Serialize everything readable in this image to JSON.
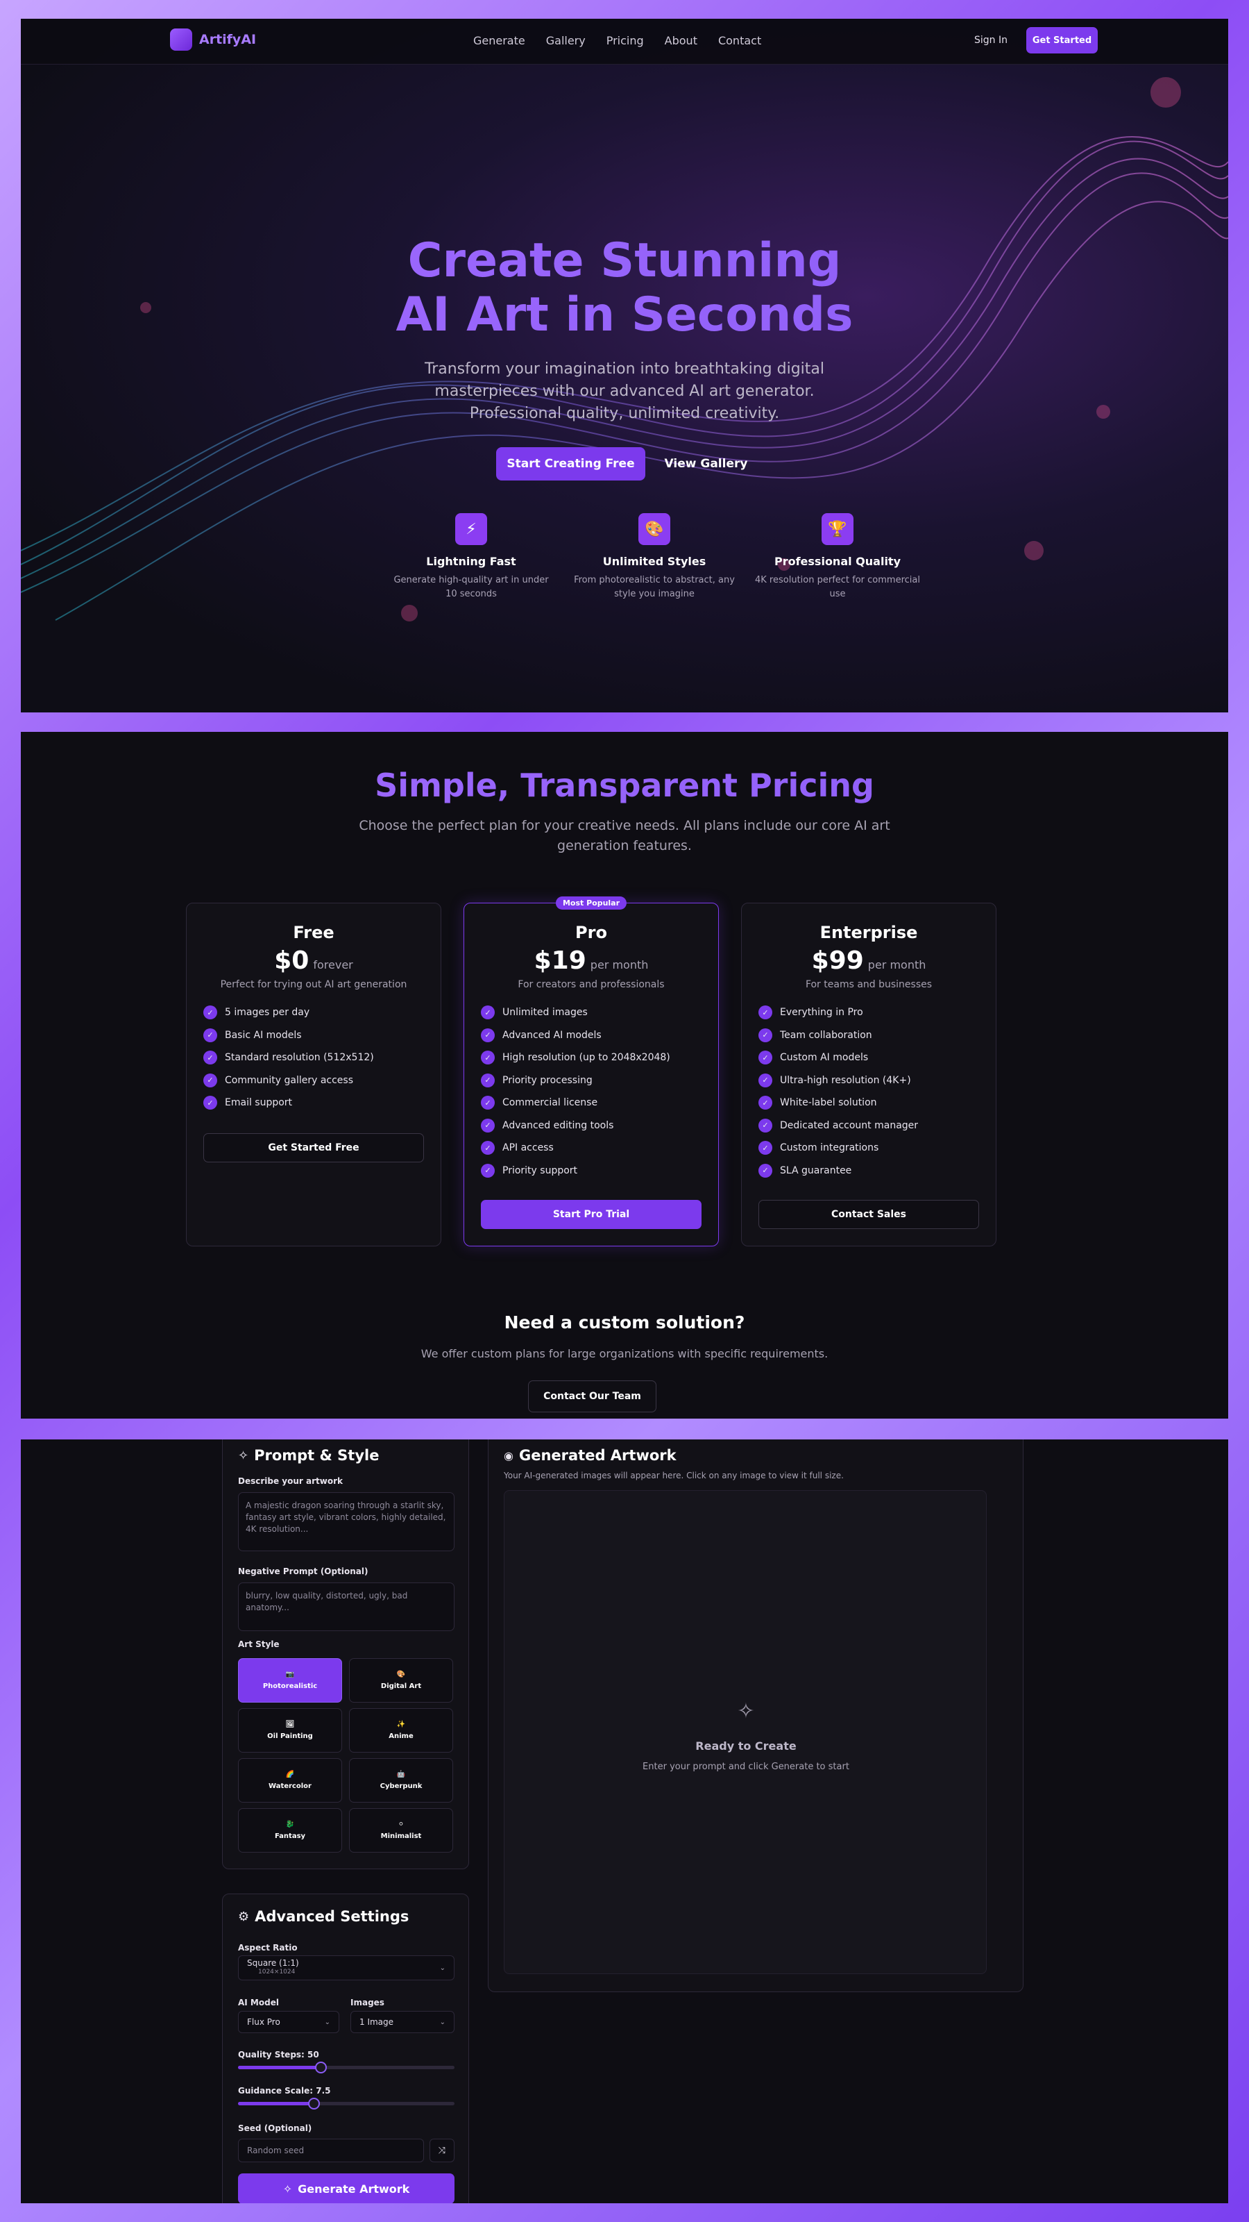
{
  "nav": {
    "brand": "ArtifyAI",
    "links": [
      "Generate",
      "Gallery",
      "Pricing",
      "About",
      "Contact"
    ],
    "sign_in": "Sign In",
    "get_started": "Get Started"
  },
  "hero": {
    "title_line1": "Create Stunning",
    "title_line2": "AI Art in Seconds",
    "subtitle": "Transform your imagination into breathtaking digital masterpieces with our advanced AI art generator. Professional quality, unlimited creativity.",
    "primary_cta": "Start Creating Free",
    "secondary_cta": "View Gallery",
    "features": [
      {
        "icon": "lightning-icon",
        "glyph": "⚡",
        "title": "Lightning Fast",
        "desc": "Generate high-quality art in under 10 seconds"
      },
      {
        "icon": "palette-icon",
        "glyph": "🎨",
        "title": "Unlimited Styles",
        "desc": "From photorealistic to abstract, any style you imagine"
      },
      {
        "icon": "trophy-icon",
        "glyph": "🏆",
        "title": "Professional Quality",
        "desc": "4K resolution perfect for commercial use"
      }
    ]
  },
  "pricing": {
    "title": "Simple, Transparent Pricing",
    "subtitle": "Choose the perfect plan for your creative needs. All plans include our core AI art generation features.",
    "plans": [
      {
        "name": "Free",
        "price": "$0",
        "period": "forever",
        "desc": "Perfect for trying out AI art generation",
        "features": [
          "5 images per day",
          "Basic AI models",
          "Standard resolution (512x512)",
          "Community gallery access",
          "Email support"
        ],
        "cta": "Get Started Free"
      },
      {
        "name": "Pro",
        "badge": "Most Popular",
        "price": "$19",
        "period": "per month",
        "desc": "For creators and professionals",
        "features": [
          "Unlimited images",
          "Advanced AI models",
          "High resolution (up to 2048x2048)",
          "Priority processing",
          "Commercial license",
          "Advanced editing tools",
          "API access",
          "Priority support"
        ],
        "cta": "Start Pro Trial"
      },
      {
        "name": "Enterprise",
        "price": "$99",
        "period": "per month",
        "desc": "For teams and businesses",
        "features": [
          "Everything in Pro",
          "Team collaboration",
          "Custom AI models",
          "Ultra-high resolution (4K+)",
          "White-label solution",
          "Dedicated account manager",
          "Custom integrations",
          "SLA guarantee"
        ],
        "cta": "Contact Sales"
      }
    ],
    "custom_title": "Need a custom solution?",
    "custom_subtitle": "We offer custom plans for large organizations with specific requirements.",
    "custom_cta": "Contact Our Team"
  },
  "generator": {
    "prompt_title": "Prompt & Style",
    "describe_label": "Describe your artwork",
    "describe_placeholder": "A majestic dragon soaring through a starlit sky, fantasy art style, vibrant colors, highly detailed, 4K resolution...",
    "negative_label": "Negative Prompt (Optional)",
    "negative_placeholder": "blurry, low quality, distorted, ugly, bad anatomy...",
    "style_label": "Art Style",
    "styles": [
      {
        "name": "Photorealistic",
        "glyph": "📷",
        "selected": true
      },
      {
        "name": "Digital Art",
        "glyph": "🎨",
        "selected": false
      },
      {
        "name": "Oil Painting",
        "glyph": "🖼",
        "selected": false
      },
      {
        "name": "Anime",
        "glyph": "✨",
        "selected": false
      },
      {
        "name": "Watercolor",
        "glyph": "🌈",
        "selected": false
      },
      {
        "name": "Cyberpunk",
        "glyph": "🤖",
        "selected": false
      },
      {
        "name": "Fantasy",
        "glyph": "🐉",
        "selected": false
      },
      {
        "name": "Minimalist",
        "glyph": "⚪",
        "selected": false
      }
    ],
    "advanced_title": "Advanced Settings",
    "aspect_label": "Aspect Ratio",
    "aspect_value": "Square (1:1)",
    "aspect_size": "1024×1024",
    "model_label": "AI Model",
    "model_value": "Flux Pro",
    "images_label": "Images",
    "images_value": "1 Image",
    "quality_label": "Quality Steps: 50",
    "quality_fraction": 0.38,
    "guidance_label": "Guidance Scale: 7.5",
    "guidance_fraction": 0.35,
    "seed_label": "Seed (Optional)",
    "seed_placeholder": "Random seed",
    "generate_cta": "Generate Artwork",
    "output_title": "Generated Artwork",
    "output_subtitle": "Your AI-generated images will appear here. Click on any image to view it full size.",
    "empty_title": "Ready to Create",
    "empty_subtitle": "Enter your prompt and click Generate to start"
  },
  "colors": {
    "accent": "#7c3aed",
    "accent_light": "#a16bff",
    "panel": "#0e0d13"
  }
}
